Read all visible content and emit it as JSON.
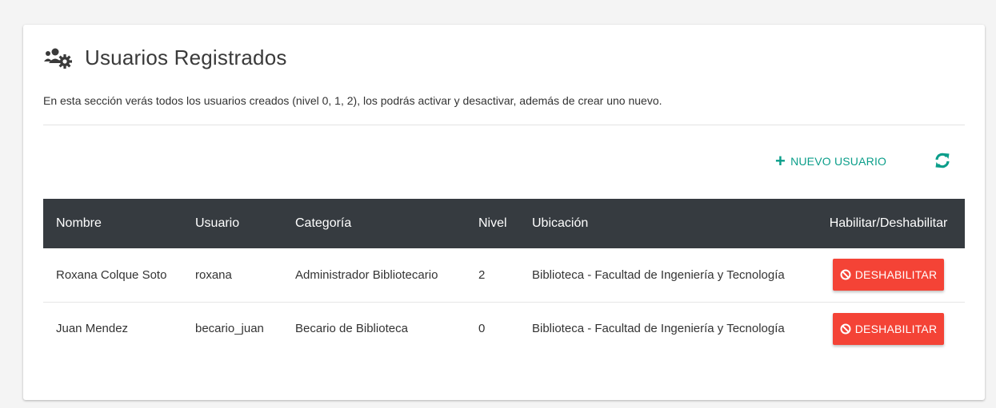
{
  "page": {
    "title": "Usuarios Registrados",
    "description": "En esta sección verás todos los usuarios creados (nivel 0, 1, 2), los podrás activar y desactivar, además de crear uno nuevo.",
    "header_icon": "users-cog-icon"
  },
  "toolbar": {
    "new_user_label": "NUEVO USUARIO",
    "new_user_icon": "plus-icon",
    "refresh_icon": "refresh-icon"
  },
  "colors": {
    "accent": "#0b9e8a",
    "table_header_bg": "#363b40",
    "danger": "#f44336"
  },
  "table": {
    "headers": [
      "Nombre",
      "Usuario",
      "Categoría",
      "Nivel",
      "Ubicación",
      "Habilitar/Deshabilitar"
    ],
    "rows": [
      {
        "nombre": "Roxana Colque Soto",
        "usuario": "roxana",
        "categoria": "Administrador Bibliotecario",
        "nivel": "2",
        "ubicacion": "Biblioteca - Facultad de Ingeniería y Tecnología",
        "action_label": "DESHABILITAR",
        "action_icon": "ban-icon"
      },
      {
        "nombre": "Juan Mendez",
        "usuario": "becario_juan",
        "categoria": "Becario de Biblioteca",
        "nivel": "0",
        "ubicacion": "Biblioteca - Facultad de Ingeniería y Tecnología",
        "action_label": "DESHABILITAR",
        "action_icon": "ban-icon"
      }
    ]
  }
}
